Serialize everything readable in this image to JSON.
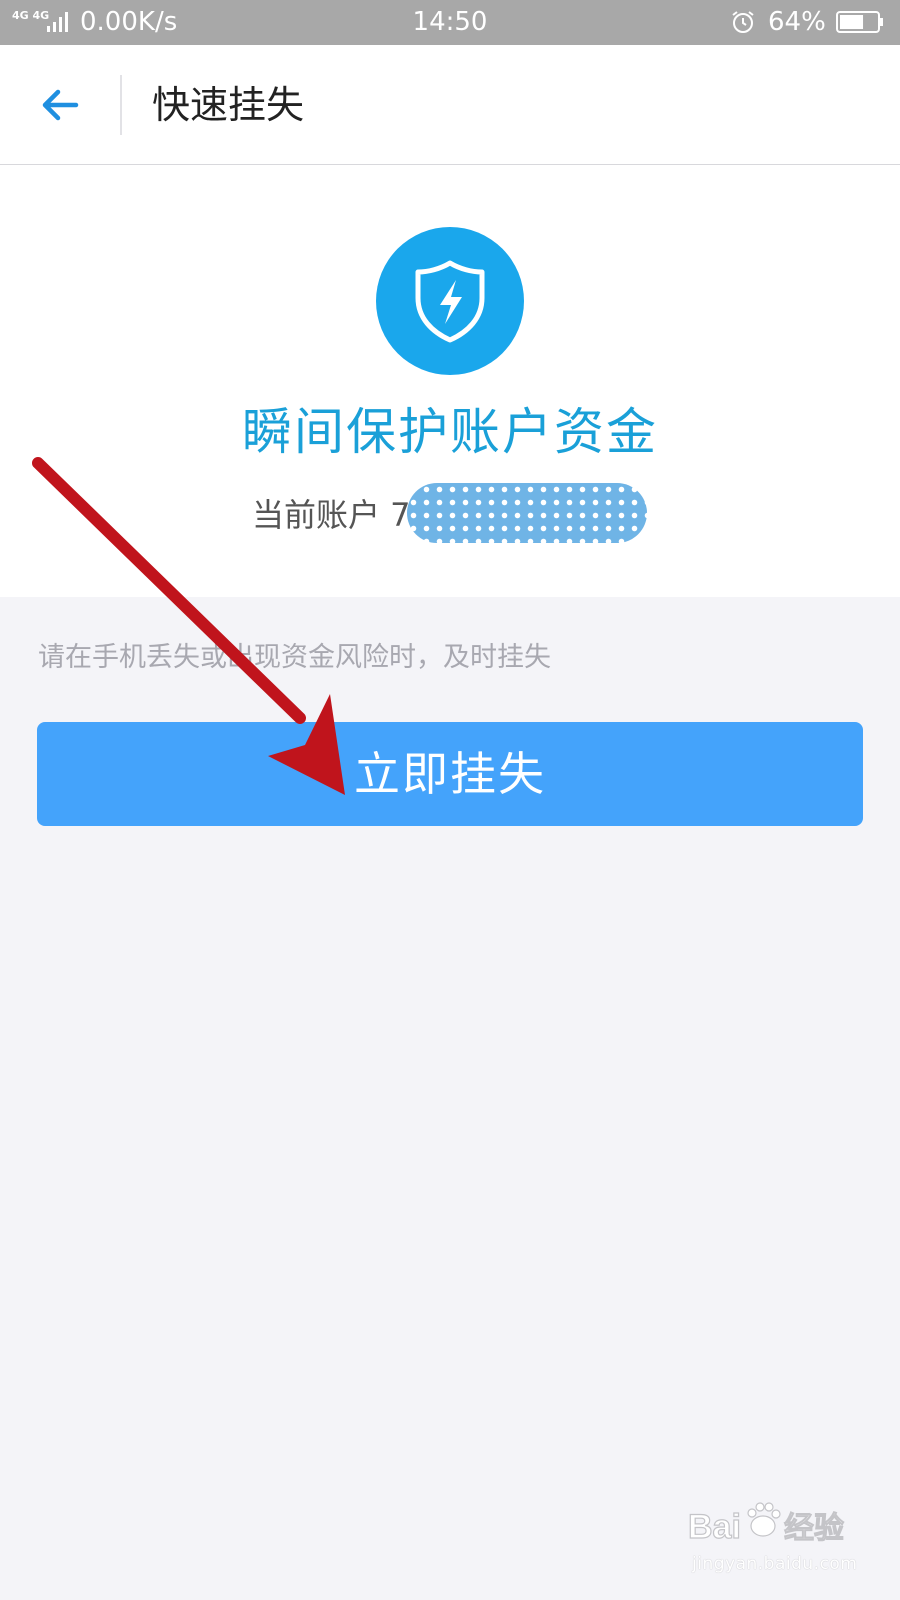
{
  "status_bar": {
    "network": "4G 4G",
    "speed": "0.00K/s",
    "time": "14:50",
    "battery": "64%",
    "battery_level": 0.64
  },
  "header": {
    "title": "快速挂失"
  },
  "hero": {
    "title": "瞬间保护账户资金",
    "account_label": "当前账户 7"
  },
  "hint": "请在手机丢失或出现资金风险时，及时挂失",
  "report_button": "立即挂失",
  "watermark": {
    "brand": "Baidu经验",
    "url": "jingyan.baidu.com"
  },
  "colors": {
    "accent": "#44a3fb",
    "shield": "#1aa7ec",
    "title": "#1aa0d8",
    "annotation_arrow": "#c0141c"
  }
}
